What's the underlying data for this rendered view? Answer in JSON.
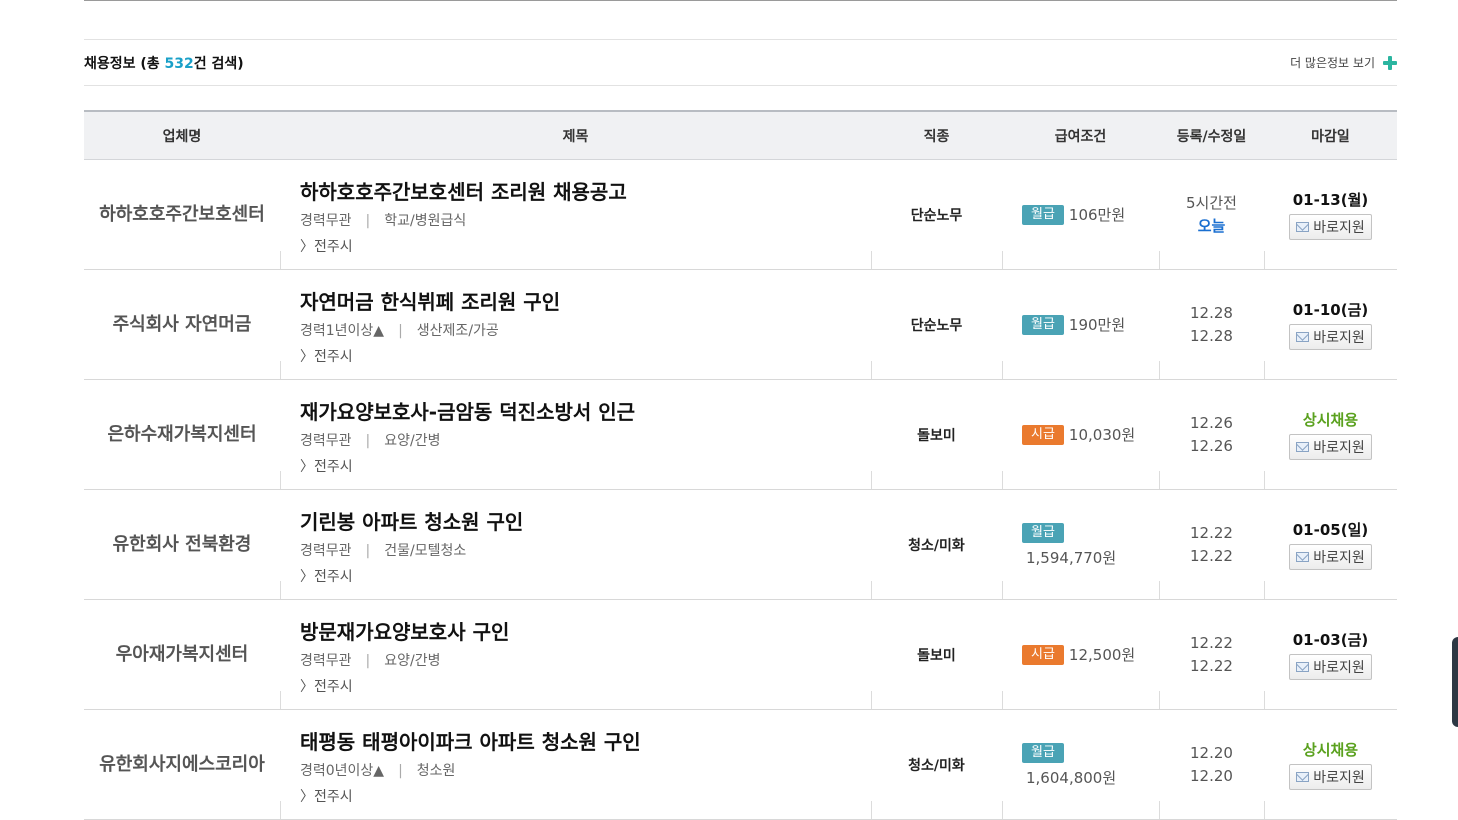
{
  "summary": {
    "prefix": "채용정보 (총 ",
    "count": "532",
    "suffix": "건 검색)",
    "more_label": "더 많은정보 보기"
  },
  "headers": {
    "company": "업체명",
    "title": "제목",
    "type": "직종",
    "pay": "급여조건",
    "date": "등록/수정일",
    "due": "마감일"
  },
  "colors": {
    "monthly": "#4aa3b5",
    "hourly": "#ea7a2e",
    "always": "#5aa11e",
    "today": "#1a6fd0",
    "count": "#1aa0c8"
  },
  "apply_label": "바로지원",
  "rows": [
    {
      "company": "하하호호주간보호센터",
      "title": "하하호호주간보호센터 조리원 채용공고",
      "career": "경력무관",
      "category": "학교/병원급식",
      "location": "전주시",
      "type": "단순노무",
      "pay_type": "월급",
      "pay_amount": "106만원",
      "reg_date": "5시간전",
      "mod_date": "오늘",
      "due": "01-13(월)"
    },
    {
      "company": "주식회사 자연머금",
      "title": "자연머금 한식뷔페 조리원 구인",
      "career": "경력1년이상▲",
      "category": "생산제조/가공",
      "location": "전주시",
      "type": "단순노무",
      "pay_type": "월급",
      "pay_amount": "190만원",
      "reg_date": "12.28",
      "mod_date": "12.28",
      "due": "01-10(금)"
    },
    {
      "company": "은하수재가복지센터",
      "title": "재가요양보호사-금암동 덕진소방서 인근",
      "career": "경력무관",
      "category": "요양/간병",
      "location": "전주시",
      "type": "돌보미",
      "pay_type": "시급",
      "pay_amount": "10,030원",
      "reg_date": "12.26",
      "mod_date": "12.26",
      "due": "상시채용"
    },
    {
      "company": "유한회사 전북환경",
      "title": "기린봉 아파트 청소원 구인",
      "career": "경력무관",
      "category": "건물/모텔청소",
      "location": "전주시",
      "type": "청소/미화",
      "pay_type": "월급",
      "pay_amount": "1,594,770원",
      "reg_date": "12.22",
      "mod_date": "12.22",
      "due": "01-05(일)"
    },
    {
      "company": "우아재가복지센터",
      "title": "방문재가요양보호사 구인",
      "career": "경력무관",
      "category": "요양/간병",
      "location": "전주시",
      "type": "돌보미",
      "pay_type": "시급",
      "pay_amount": "12,500원",
      "reg_date": "12.22",
      "mod_date": "12.22",
      "due": "01-03(금)"
    },
    {
      "company": "유한회사지에스코리아",
      "title": "태평동 태평아이파크 아파트 청소원 구인",
      "career": "경력0년이상▲",
      "category": "청소원",
      "location": "전주시",
      "type": "청소/미화",
      "pay_type": "월급",
      "pay_amount": "1,604,800원",
      "reg_date": "12.20",
      "mod_date": "12.20",
      "due": "상시채용"
    }
  ]
}
